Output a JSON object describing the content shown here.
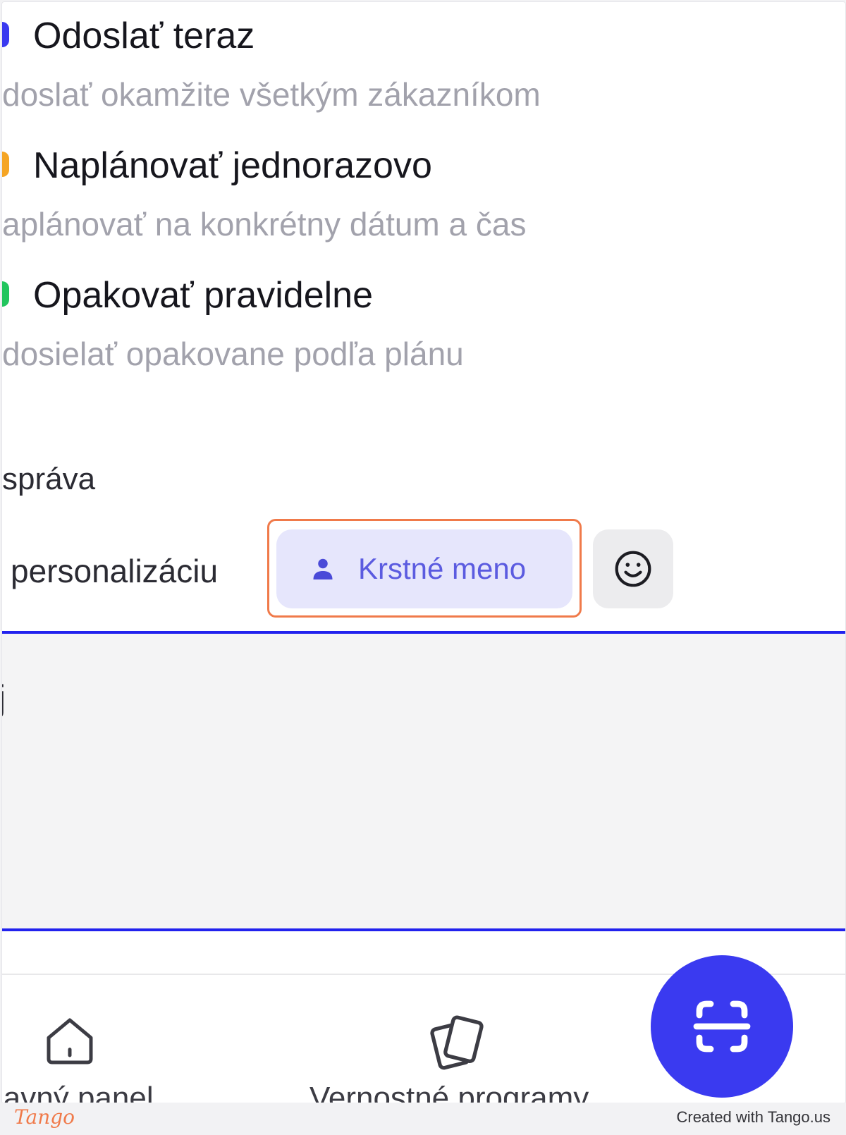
{
  "options": [
    {
      "title": "Odoslať teraz",
      "description": "doslať okamžite všetkým zákazníkom",
      "bullet_color": "#3a3af0"
    },
    {
      "title": "Naplánovať jednorazovo",
      "description": "aplánovať na konkrétny dátum a čas",
      "bullet_color": "#f5a524"
    },
    {
      "title": "Opakovať pravidelne",
      "description": "dosielať opakovane podľa plánu",
      "bullet_color": "#22c55e"
    }
  ],
  "message": {
    "section_label": "správa",
    "personalize_label": "personalizáciu",
    "chip_label": "Krstné meno",
    "chip_icon": "person-icon",
    "emoji_icon": "smiley-icon",
    "text_value": "j"
  },
  "nav": {
    "items": [
      {
        "label": "lavný panel",
        "icon": "home-icon"
      },
      {
        "label": "Vernostné programy",
        "icon": "cards-icon"
      }
    ],
    "fab_icon": "scan-icon"
  },
  "footer": {
    "brand": "Tango",
    "credit": "Created with Tango.us"
  },
  "colors": {
    "accent": "#3a3af0",
    "highlight": "#f07a4a",
    "chip_bg": "#e6e6fc"
  }
}
